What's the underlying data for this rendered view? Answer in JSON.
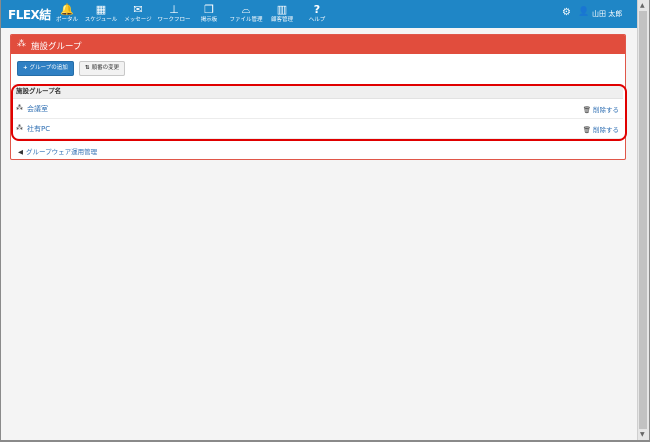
{
  "app": {
    "logo": "FLEX結"
  },
  "nav": [
    {
      "label": "ポータル",
      "icon": "bell-icon",
      "glyph": "🔔"
    },
    {
      "label": "スケジュール",
      "icon": "calendar-icon",
      "glyph": "▦"
    },
    {
      "label": "メッセージ",
      "icon": "envelope-icon",
      "glyph": "✉"
    },
    {
      "label": "ワークフロー",
      "icon": "stamp-icon",
      "glyph": "⊥"
    },
    {
      "label": "掲示板",
      "icon": "documents-icon",
      "glyph": "❐"
    },
    {
      "label": "ファイル管理",
      "icon": "drive-icon",
      "glyph": "⌓"
    },
    {
      "label": "顧客管理",
      "icon": "building-icon",
      "glyph": "▥"
    },
    {
      "label": "ヘルプ",
      "icon": "question-icon",
      "glyph": "?"
    }
  ],
  "header_right": {
    "settings_icon": "cogs-icon",
    "settings_glyph": "⚙",
    "user_icon": "user-icon",
    "user_glyph": "👤",
    "user_name": "山田  太郎"
  },
  "panel": {
    "title": "施設グループ",
    "title_icon": "cubes-icon",
    "title_glyph": "⁂",
    "add_button": "グループの追加",
    "add_glyph": "+",
    "order_button": "順番の変更",
    "order_glyph": "⇅",
    "column_header": "施設グループ名",
    "rows": [
      {
        "name": "会議室",
        "delete": "削除する"
      },
      {
        "name": "社有PC",
        "delete": "削除する"
      }
    ],
    "row_glyph": "⁂",
    "delete_glyph": "🗑",
    "back_link": "グループウェア運用管理",
    "back_glyph": "◀"
  },
  "colors": {
    "topbar": "#1f86c6",
    "panel_header": "#e14d3d",
    "highlight": "#e00000",
    "link": "#2f6fb3"
  }
}
